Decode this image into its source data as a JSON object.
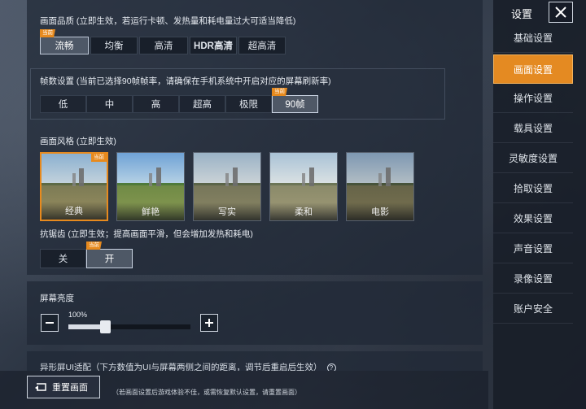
{
  "quality": {
    "title": "画面品质 (立即生效，若运行卡顿、发热量和耗电量过大可适当降低)",
    "options": [
      "流畅",
      "均衡",
      "高清",
      "HDR高清",
      "超高清"
    ],
    "selected_index": 0
  },
  "fps": {
    "title": "帧数设置 (当前已选择90帧帧率，请确保在手机系统中开启对应的屏幕刷新率)",
    "options": [
      "低",
      "中",
      "高",
      "超高",
      "极限",
      "90帧"
    ],
    "selected_index": 5
  },
  "current_tag": "当前",
  "style": {
    "title": "画面风格 (立即生效)",
    "options": [
      "经典",
      "鲜艳",
      "写实",
      "柔和",
      "电影"
    ],
    "selected_index": 0
  },
  "antialias": {
    "title": "抗锯齿 (立即生效；提高画面平滑，但会增加发热和耗电)",
    "options": [
      "关",
      "开"
    ],
    "selected_index": 1
  },
  "brightness": {
    "title": "屏幕亮度",
    "value": "100%",
    "level": 0.3
  },
  "notch": {
    "title": "异形屏UI适配（下方数值为UI与屏幕两侧之间的距离，调节后重启后生效）"
  },
  "reset": {
    "label": "重置画面",
    "hint": "（若画面设置后游戏体验不佳，或需恢复默认设置，请重置画面）"
  },
  "sidebar": {
    "title": "设置",
    "items": [
      "基础设置",
      "画面设置",
      "操作设置",
      "载具设置",
      "灵敏度设置",
      "拾取设置",
      "效果设置",
      "声音设置",
      "录像设置",
      "账户安全"
    ],
    "active_index": 1
  },
  "colors": {
    "accent": "#e48a22"
  }
}
